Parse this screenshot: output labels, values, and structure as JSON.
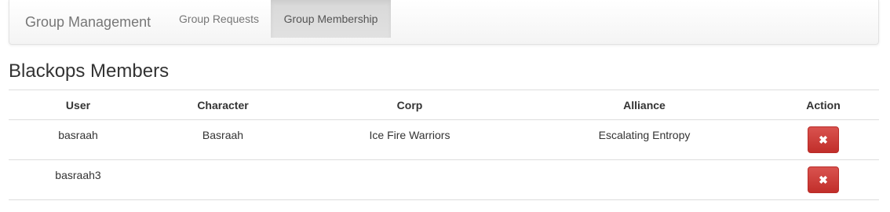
{
  "navbar": {
    "brand": "Group Management",
    "tabs": [
      {
        "label": "Group Requests",
        "active": false
      },
      {
        "label": "Group Membership",
        "active": true
      }
    ]
  },
  "page": {
    "title": "Blackops Members"
  },
  "table": {
    "headers": [
      "User",
      "Character",
      "Corp",
      "Alliance",
      "Action"
    ],
    "rows": [
      {
        "user": "basraah",
        "character": "Basraah",
        "corp": "Ice Fire Warriors",
        "alliance": "Escalating Entropy",
        "action_icon": "✖"
      },
      {
        "user": "basraah3",
        "character": "",
        "corp": "",
        "alliance": "",
        "action_icon": "✖"
      }
    ]
  },
  "colors": {
    "danger": "#d9534f",
    "active_tab_bg": "#dddddd",
    "muted_text": "#777777"
  },
  "icons": {
    "remove": "close-icon"
  }
}
